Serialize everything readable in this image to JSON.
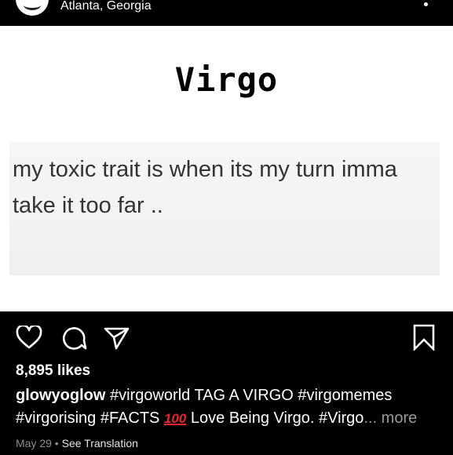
{
  "header": {
    "location": "Atlanta, Georgia"
  },
  "post": {
    "title": "Virgo",
    "text": "my toxic trait is when its my turn imma take it too far .."
  },
  "actions": {
    "like_icon": "heart-icon",
    "comment_icon": "comment-icon",
    "share_icon": "send-icon",
    "save_icon": "bookmark-icon"
  },
  "likes": "8,895 likes",
  "caption": {
    "username": "glowyoglow",
    "text_before": " #virgoworld TAG A VIRGO #virgomemes #virgorising #FACTS ",
    "emoji": "100",
    "text_after": " Love Being Virgo. #Virgo",
    "ellipsis": "...",
    "more_label": " more"
  },
  "meta": {
    "date": "May 29",
    "separator": " • ",
    "translate_label": "See Translation"
  },
  "colors": {
    "background": "#000000",
    "post_bg": "#ffffff",
    "muted": "#8e8e8e",
    "emoji_red": "#e8252e"
  }
}
